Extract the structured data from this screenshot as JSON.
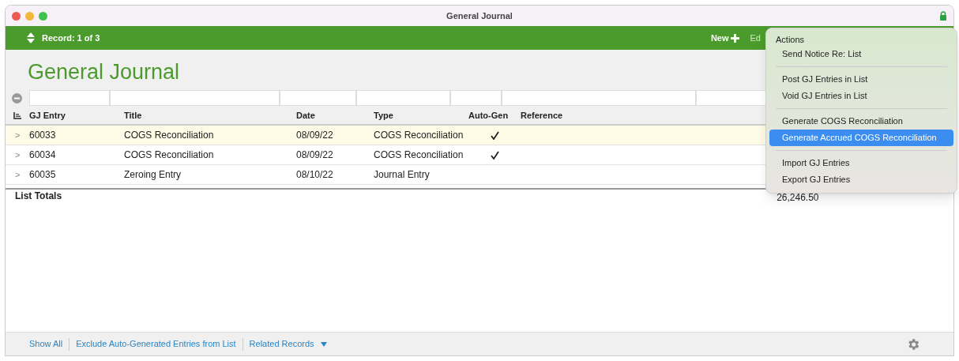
{
  "window": {
    "title": "General Journal"
  },
  "toolbar": {
    "record": "Record: 1 of 3",
    "new_label": "New",
    "edit_label": "Ed"
  },
  "heading": "General Journal",
  "table": {
    "columns": [
      "GJ Entry",
      "Title",
      "Date",
      "Type",
      "Auto-Gen",
      "Reference"
    ],
    "rows": [
      {
        "expander": ">",
        "entry": "60033",
        "title": "COGS Reconciliation",
        "date": "08/09/22",
        "type": "COGS Reconciliation",
        "auto_gen": true,
        "selected": true
      },
      {
        "expander": ">",
        "entry": "60034",
        "title": "COGS Reconciliation",
        "date": "08/09/22",
        "type": "COGS Reconciliation",
        "auto_gen": true,
        "selected": false
      },
      {
        "expander": ">",
        "entry": "60035",
        "title": "Zeroing Entry",
        "date": "08/10/22",
        "type": "Journal Entry",
        "auto_gen": false,
        "selected": false
      }
    ],
    "totals_label": "List Totals",
    "totals_value": "26,246.50"
  },
  "menu": {
    "title": "Actions",
    "groups": [
      [
        {
          "label": "Send Notice Re: List",
          "selected": false
        }
      ],
      [
        {
          "label": "Post GJ Entries in List",
          "selected": false
        },
        {
          "label": "Void GJ Entries in List",
          "selected": false
        }
      ],
      [
        {
          "label": "Generate COGS Reconciliation",
          "selected": false
        },
        {
          "label": "Generate Accrued COGS Reconciliation",
          "selected": true
        }
      ],
      [
        {
          "label": "Import GJ Entries",
          "selected": false
        },
        {
          "label": "Export GJ Entries",
          "selected": false
        }
      ]
    ]
  },
  "footer": {
    "links": [
      "Show All",
      "Exclude Auto-Generated Entries from List"
    ],
    "related": "Related Records"
  }
}
